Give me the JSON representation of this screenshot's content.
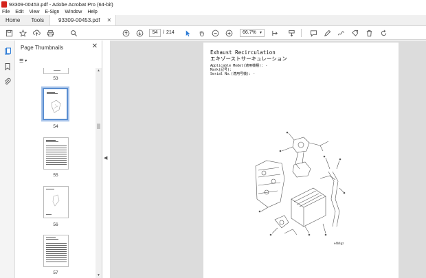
{
  "window": {
    "title": "93309-00453.pdf - Adobe Acrobat Pro (64-bit)"
  },
  "menu": [
    "File",
    "Edit",
    "View",
    "E-Sign",
    "Window",
    "Help"
  ],
  "tabs": {
    "home": "Home",
    "tools": "Tools",
    "document": "93309-00453.pdf"
  },
  "toolbar": {
    "current_page": "54",
    "page_separator": "/",
    "total_pages": "214",
    "zoom": "66.7%"
  },
  "panel": {
    "title": "Page Thumbnails",
    "thumbnails": [
      {
        "label": "53"
      },
      {
        "label": "54"
      },
      {
        "label": "55"
      },
      {
        "label": "56"
      },
      {
        "label": "57"
      }
    ]
  },
  "document": {
    "title_en": "Exhaust Recirculation",
    "title_jp": "エキゾーストサーキュレーション",
    "applicable_model": "Applicable Model(適用機種): -",
    "mark": "Mark(記号):",
    "serial_no": "Serial No.(適用号機): -",
    "drawing_code": "e4b4gz"
  },
  "colors": {
    "accent": "#2c7bd6",
    "pdf_red": "#d4231c",
    "viewer_bg": "#dcdcdc"
  }
}
